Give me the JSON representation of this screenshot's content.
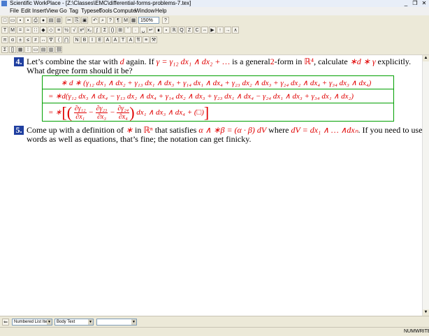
{
  "window": {
    "title": "Scientific WorkPlace - [Z:\\Classes\\EMC\\differential-forms-problems-7.tex]"
  },
  "menu": [
    "File",
    "Edit",
    "Insert",
    "View",
    "Go",
    "Tag",
    "Typeset",
    "Tools",
    "Compute",
    "Window",
    "Help"
  ],
  "toolbar": {
    "zoom_value": "150%"
  },
  "problem4": {
    "number": "4.",
    "intro": "Let’s combine the star with",
    "d": "d",
    "again_if": "again. If",
    "gamma_def": "γ = γ₁₂ dx₁ ∧ dx₂ + …",
    "is_general": "is a general",
    "two": "2",
    "form_in": "-form in",
    "R4": "ℝ⁴",
    "calculate": ", calculate",
    "star_expr": "∗d ∗ γ",
    "explicitly": "explicitly.",
    "line2": "What degree form should it be?"
  },
  "math": {
    "row1": "∗ d ∗ (γ₁₂ dx₁ ∧ dx₂ + γ₁₃ dx₁ ∧ dx₃ + γ₁₄ dx₁ ∧ dx₄ + γ₂₃ dx₂ ∧ dx₃ + γ₂₄ dx₂ ∧ dx₄ + γ₃₄ dx₃ ∧ dx₄)",
    "row2": "= ∗d(γ₁₂ dx₃ ∧ dx₄ − γ₁₃ dx₂ ∧ dx₄ + γ₁₄ dx₂ ∧ dx₃ + γ₂₃ dx₁ ∧ dx₄ − γ₂₄ dx₁ ∧ dx₃ + γ₃₄ dx₁ ∧ dx₂)",
    "row3_prefix": "= ∗",
    "f1n": "∂γ₁₂",
    "f1d": "∂x₁",
    "minus": "−",
    "f2n": "∂γ₂₃",
    "f2d": "∂x₃",
    "f3n": "∂γ₂₄",
    "f3d": "∂x₄",
    "row3_tail": "dx₁ ∧ dx₃ ∧ dx₄ + (□)"
  },
  "problem5": {
    "number": "5.",
    "text1": "Come up with a definition of",
    "star": "∗",
    "in": "in",
    "Rn": "ℝⁿ",
    "that_satisfies": "that satisfies",
    "eq": "α ∧ ∗β = (α · β) dV",
    "where": "where",
    "dV": "dV = dx₁ ∧ … ∧dxₙ",
    "text_end": ". If you need to use",
    "line2": "words as well as equations, that’s fine; the notation can get finicky."
  },
  "status": {
    "list_style": "Numbered List Item",
    "text_style": "Body Text",
    "third": "",
    "num": "NUM",
    "mode": "WRITE"
  }
}
